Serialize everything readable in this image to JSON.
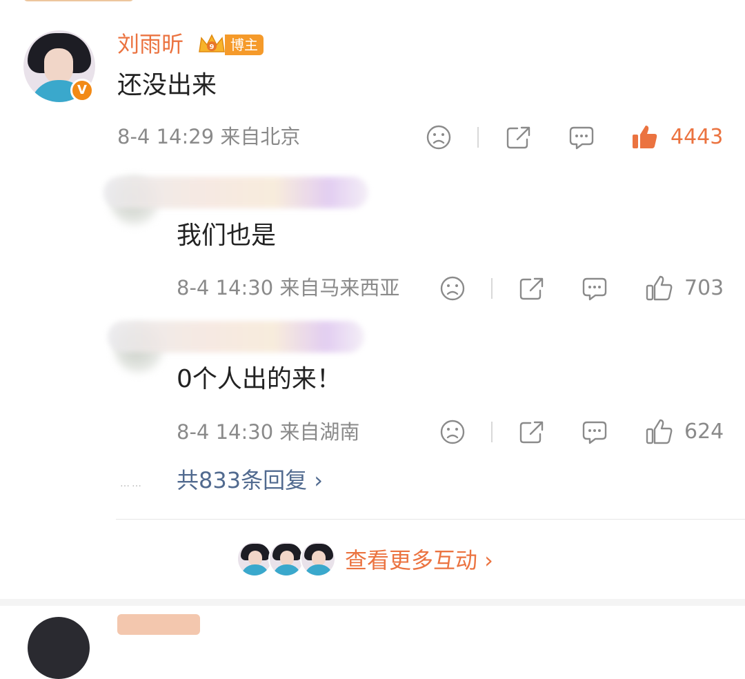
{
  "comment": {
    "username": "刘雨昕",
    "badge_label": "博主",
    "text": "还没出来",
    "timestamp": "8-4 14:29",
    "location": "来自北京",
    "likes": "4443"
  },
  "replies": [
    {
      "text": "我们也是",
      "timestamp": "8-4 14:30",
      "location": "来自马来西亚",
      "likes": "703"
    },
    {
      "text": "0个人出的来！",
      "timestamp": "8-4 14:30",
      "location": "来自湖南",
      "likes": "624"
    }
  ],
  "more_replies": {
    "dots": "……",
    "label": "共833条回复 ›"
  },
  "view_more_interactions": "查看更多互动 ›",
  "colors": {
    "accent": "#eb7340",
    "link": "#516a8f",
    "meta": "#8a8a8a"
  },
  "icons": [
    "sad-face-icon",
    "share-icon",
    "comment-icon",
    "like-icon",
    "crown-icon",
    "verified-icon"
  ]
}
